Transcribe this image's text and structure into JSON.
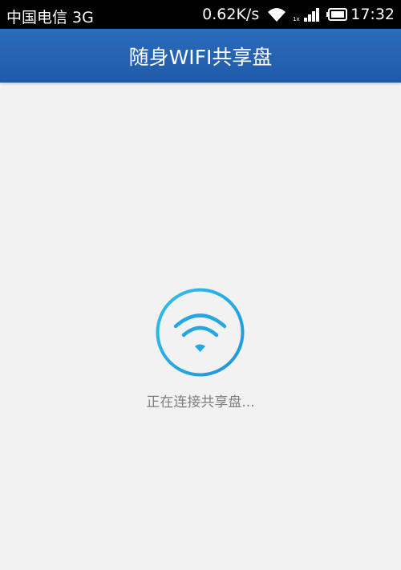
{
  "status_bar": {
    "carrier": "中国电信 3G",
    "speed": "0.62K/s",
    "time": "17:32",
    "icons": [
      "wifi-icon",
      "signal-icon",
      "battery-icon"
    ]
  },
  "app_bar": {
    "title": "随身WIFI共享盘",
    "color": "#2566b6"
  },
  "main": {
    "loader_icon": "wifi-icon",
    "loading_text": "正在连接共享盘...",
    "accent_color": "#27aee6"
  }
}
